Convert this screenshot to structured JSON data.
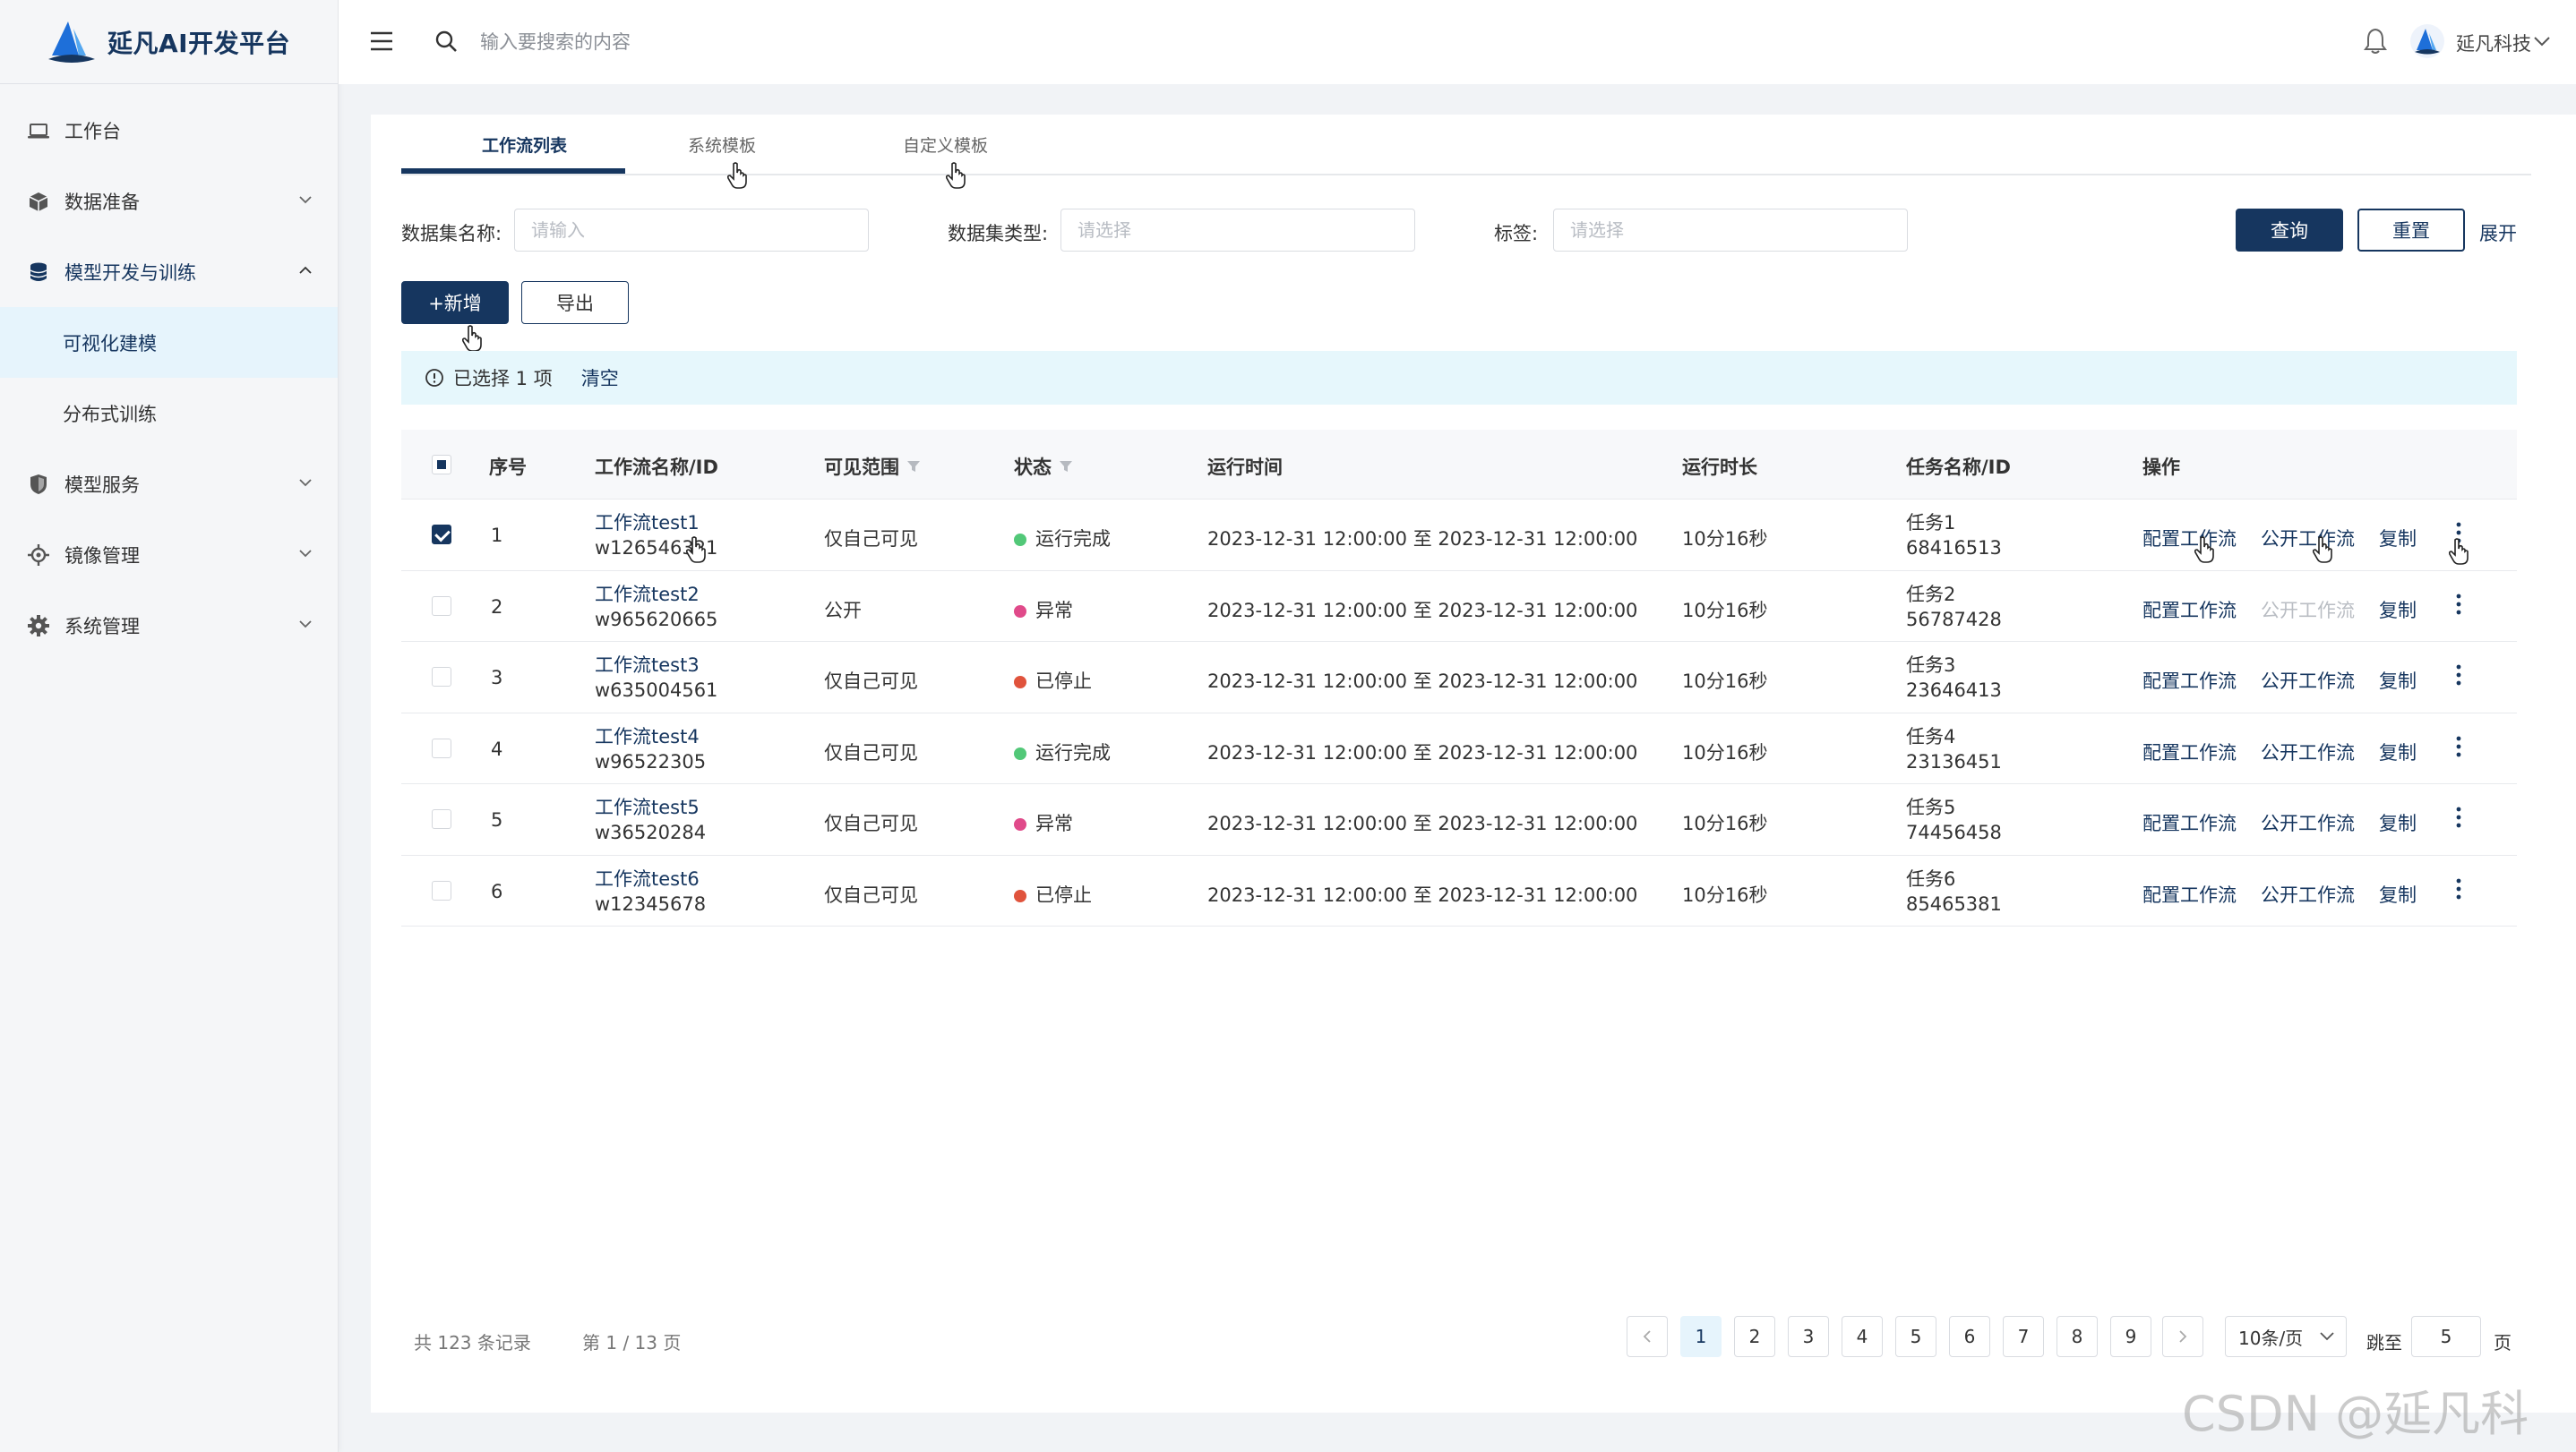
{
  "app": {
    "title": "延凡AI开发平台"
  },
  "sidebar": {
    "items": [
      {
        "label": "工作台",
        "icon": "laptop-icon"
      },
      {
        "label": "数据准备",
        "icon": "cube-icon",
        "expandable": true
      },
      {
        "label": "模型开发与训练",
        "icon": "database-icon",
        "expanded": true,
        "children": [
          {
            "label": "可视化建模",
            "active": true
          },
          {
            "label": "分布式训练"
          }
        ]
      },
      {
        "label": "模型服务",
        "icon": "shield-icon",
        "expandable": true
      },
      {
        "label": "镜像管理",
        "icon": "target-icon",
        "expandable": true
      },
      {
        "label": "系统管理",
        "icon": "gear-icon",
        "expandable": true
      }
    ]
  },
  "header": {
    "search_placeholder": "输入要搜索的内容",
    "user": "延凡科技"
  },
  "tabs": [
    {
      "label": "工作流列表",
      "active": true
    },
    {
      "label": "系统模板"
    },
    {
      "label": "自定义模板"
    }
  ],
  "filters": {
    "dataset_name": {
      "label": "数据集名称:",
      "placeholder": "请输入"
    },
    "dataset_type": {
      "label": "数据集类型:",
      "placeholder": "请选择"
    },
    "tag": {
      "label": "标签:",
      "placeholder": "请选择"
    },
    "query": "查询",
    "reset": "重置",
    "expand": "展开"
  },
  "actions": {
    "add": "+新增",
    "export": "导出"
  },
  "alert": {
    "text": "已选择 1 项",
    "clear": "清空"
  },
  "table": {
    "columns": {
      "index": "序号",
      "name": "工作流名称/ID",
      "scope": "可见范围",
      "status": "状态",
      "run_time": "运行时间",
      "duration": "运行时长",
      "task": "任务名称/ID",
      "ops": "操作"
    },
    "op_labels": {
      "config": "配置工作流",
      "publish": "公开工作流",
      "copy": "复制"
    },
    "rows": [
      {
        "index": "1",
        "name": "工作流test1",
        "id": "w126546321",
        "scope": "仅自己可见",
        "status": "运行完成",
        "status_color": "#52c878",
        "run_time": "2023-12-31 12:00:00 至 2023-12-31 12:00:00",
        "duration": "10分16秒",
        "task": "任务1",
        "task_id": "68416513",
        "checked": true,
        "publish_disabled": false
      },
      {
        "index": "2",
        "name": "工作流test2",
        "id": "w965620665",
        "scope": "公开",
        "status": "异常",
        "status_color": "#e04a8a",
        "run_time": "2023-12-31 12:00:00 至 2023-12-31 12:00:00",
        "duration": "10分16秒",
        "task": "任务2",
        "task_id": "56787428",
        "checked": false,
        "publish_disabled": true
      },
      {
        "index": "3",
        "name": "工作流test3",
        "id": "w635004561",
        "scope": "仅自己可见",
        "status": "已停止",
        "status_color": "#e0533c",
        "run_time": "2023-12-31 12:00:00 至 2023-12-31 12:00:00",
        "duration": "10分16秒",
        "task": "任务3",
        "task_id": "23646413",
        "checked": false,
        "publish_disabled": false
      },
      {
        "index": "4",
        "name": "工作流test4",
        "id": "w96522305",
        "scope": "仅自己可见",
        "status": "运行完成",
        "status_color": "#52c878",
        "run_time": "2023-12-31 12:00:00 至 2023-12-31 12:00:00",
        "duration": "10分16秒",
        "task": "任务4",
        "task_id": "23136451",
        "checked": false,
        "publish_disabled": false
      },
      {
        "index": "5",
        "name": "工作流test5",
        "id": "w36520284",
        "scope": "仅自己可见",
        "status": "异常",
        "status_color": "#e04a8a",
        "run_time": "2023-12-31 12:00:00 至 2023-12-31 12:00:00",
        "duration": "10分16秒",
        "task": "任务5",
        "task_id": "74456458",
        "checked": false,
        "publish_disabled": false
      },
      {
        "index": "6",
        "name": "工作流test6",
        "id": "w12345678",
        "scope": "仅自己可见",
        "status": "已停止",
        "status_color": "#e0533c",
        "run_time": "2023-12-31 12:00:00 至 2023-12-31 12:00:00",
        "duration": "10分16秒",
        "task": "任务6",
        "task_id": "85465381",
        "checked": false,
        "publish_disabled": false
      }
    ]
  },
  "pagination": {
    "total": "共 123 条记录",
    "page_info": "第 1 / 13 页",
    "pages": [
      "1",
      "2",
      "3",
      "4",
      "5",
      "6",
      "7",
      "8",
      "9"
    ],
    "current": "1",
    "page_size": "10条/页",
    "jump_label": "跳至",
    "jump_value": "5",
    "page_unit": "页"
  },
  "watermark": "CSDN @延凡科技",
  "colors": {
    "primary": "#16365f",
    "active_bg": "#e6f4fc",
    "alert_bg": "#e6f7fc"
  }
}
